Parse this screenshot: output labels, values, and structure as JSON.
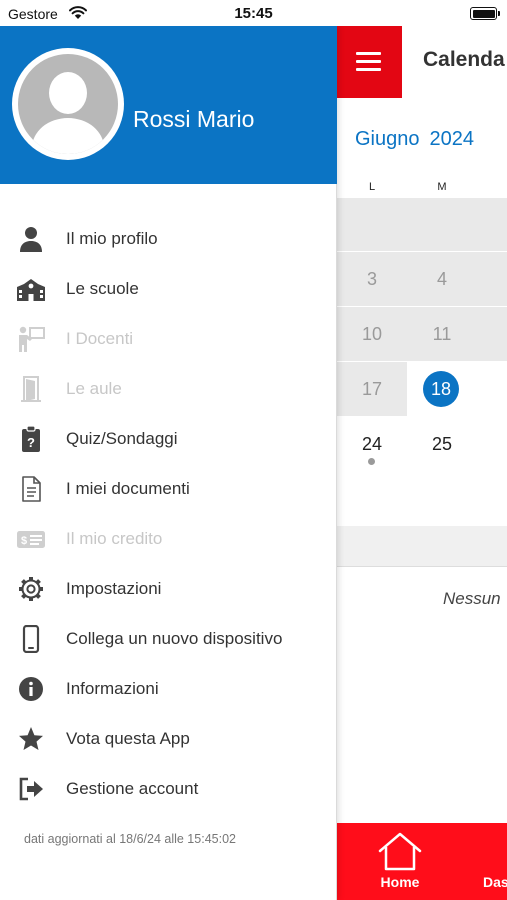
{
  "status_bar": {
    "carrier": "Gestore",
    "time": "15:45"
  },
  "calendar": {
    "title": "Calenda",
    "month": "Giugno",
    "year": "2024",
    "weekdays": [
      "L",
      "M"
    ],
    "rows": [
      [
        "3",
        "4"
      ],
      [
        "10",
        "11"
      ],
      [
        "17",
        "18"
      ],
      [
        "24",
        "25"
      ]
    ],
    "empty_message": "Nessun"
  },
  "bottom_nav": {
    "home_label": "Home",
    "second_label_partial": "Das"
  },
  "drawer": {
    "user_name": "Rossi Mario",
    "items": [
      {
        "label": "Il mio profilo",
        "icon": "person-icon",
        "enabled": true
      },
      {
        "label": "Le scuole",
        "icon": "school-icon",
        "enabled": true
      },
      {
        "label": "I Docenti",
        "icon": "teacher-icon",
        "enabled": false
      },
      {
        "label": "Le aule",
        "icon": "door-icon",
        "enabled": false
      },
      {
        "label": "Quiz/Sondaggi",
        "icon": "quiz-clipboard-icon",
        "enabled": true
      },
      {
        "label": "I miei documenti",
        "icon": "document-icon",
        "enabled": true
      },
      {
        "label": "Il mio credito",
        "icon": "money-card-icon",
        "enabled": false
      },
      {
        "label": "Impostazioni",
        "icon": "gear-icon",
        "enabled": true
      },
      {
        "label": "Collega un nuovo dispositivo",
        "icon": "smartphone-icon",
        "enabled": true
      },
      {
        "label": "Informazioni",
        "icon": "info-icon",
        "enabled": true
      },
      {
        "label": "Vota questa App",
        "icon": "star-icon",
        "enabled": true
      },
      {
        "label": "Gestione account",
        "icon": "logout-icon",
        "enabled": true
      }
    ],
    "updated_text": "dati aggiornati al 18/6/24 alle 15:45:02"
  },
  "colors": {
    "brand_blue": "#0b74c4",
    "brand_red": "#e30613",
    "nav_red": "#ff0d1a",
    "disabled_grey": "#c7c7c7"
  }
}
